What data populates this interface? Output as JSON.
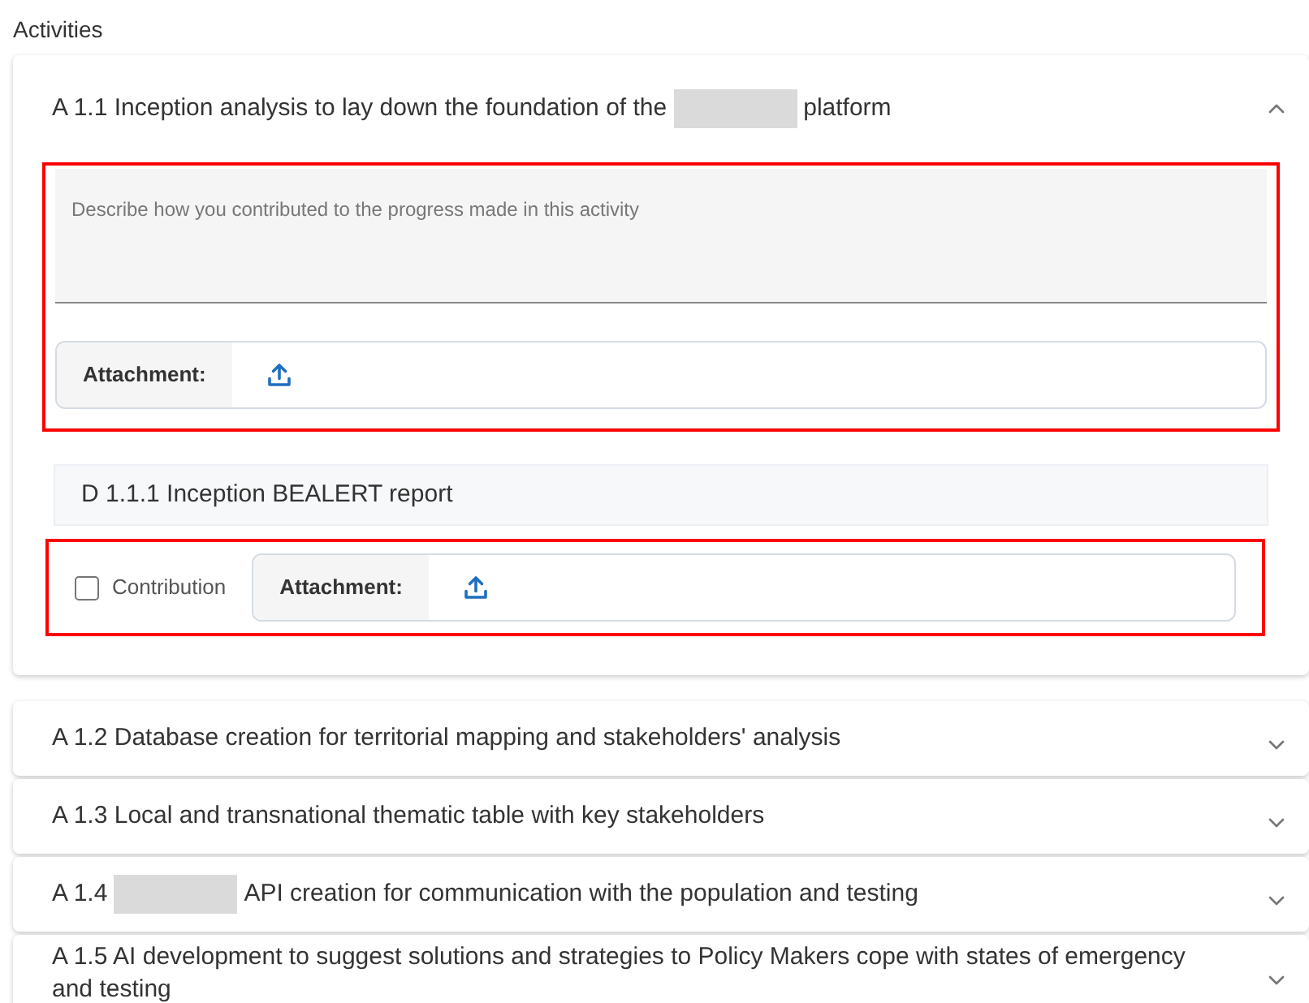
{
  "heading": "Activities",
  "activities": [
    {
      "title_start": "A 1.1 Inception analysis to lay down the foundation of the",
      "redacted": true,
      "title_end": "platform",
      "expanded": true,
      "description": {
        "placeholder": "Describe how you contributed to the progress made in this activity",
        "highlighted": true
      },
      "attachment": {
        "label": "Attachment:"
      },
      "deliverables": [
        {
          "title": "D 1.1.1 Inception BEALERT report",
          "contribution": {
            "label": "Contribution",
            "checked": false
          },
          "attachment": {
            "label": "Attachment:"
          },
          "highlighted": true
        }
      ]
    },
    {
      "title_start": "A 1.2 Database creation for territorial mapping and stakeholders' analysis",
      "redacted": false,
      "expanded": false
    },
    {
      "title_start": "A 1.3 Local and transnational thematic table with key stakeholders",
      "redacted": false,
      "expanded": false
    },
    {
      "title_start": "A 1.4",
      "redacted": true,
      "title_end": "API creation for communication with the population and testing",
      "expanded": false
    },
    {
      "title_start": "A 1.5 AI development to suggest solutions and strategies to Policy Makers cope with states of emergency and testing",
      "redacted": false,
      "expanded": false
    }
  ]
}
